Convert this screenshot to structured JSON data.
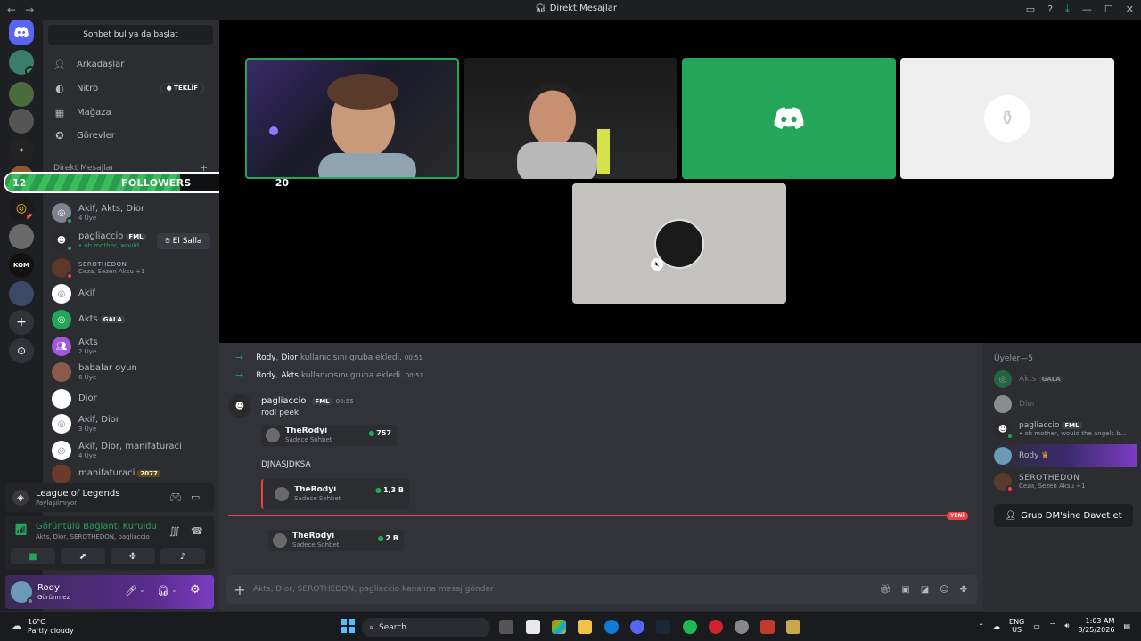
{
  "window": {
    "title": "Direkt Mesajlar"
  },
  "sidebar": {
    "search_label": "Sohbet bul ya da başlat",
    "nav": [
      {
        "label": "Arkadaşlar",
        "icon": "friends-icon"
      },
      {
        "label": "Nitro",
        "icon": "nitro-icon",
        "badge": "TEKLİF"
      },
      {
        "label": "Mağaza",
        "icon": "store-icon"
      },
      {
        "label": "Görevler",
        "icon": "quests-icon"
      }
    ],
    "dm_header": "Direkt Mesajlar",
    "dms": [
      {
        "name": "Akif, Akts, Dior",
        "sub": "4 Üye"
      },
      {
        "name": "pagliaccio",
        "tag": "FML",
        "sub": "• oh mother, would..."
      },
      {
        "name": "SEROTHEDON",
        "sub": "Ceza, Sezen Aksu +1"
      },
      {
        "name": "Akif",
        "sub": ""
      },
      {
        "name": "Akts",
        "tag": "GALA",
        "sub": ""
      },
      {
        "name": "Akts",
        "sub": "2 Üye"
      },
      {
        "name": "babalar oyun",
        "sub": "6 Üye"
      },
      {
        "name": "Dior",
        "sub": ""
      },
      {
        "name": "Akif, Dior",
        "sub": "3 Üye"
      },
      {
        "name": "Akif, Dior, manifaturaci",
        "sub": "4 Üye"
      },
      {
        "name": "manifaturaci",
        "tag": "2077",
        "sub": ""
      }
    ],
    "wave_label": "El Salla",
    "game": {
      "name": "League of Legends",
      "status": "Paylaşılmıyor"
    },
    "voice": {
      "title": "Görüntülü Bağlantı Kuruldu",
      "members": "Akts, Dior, SEROTHEDON, pagliaccio"
    },
    "user": {
      "name": "Rody",
      "status": "Görünmez"
    }
  },
  "followers_widget": {
    "current": "12",
    "label": "FOLLOWERS",
    "goal": "20",
    "progress": 0.6
  },
  "chat": {
    "system_messages": [
      {
        "actor": "Rody",
        "target": "Dior",
        "text": "kullanıcısını gruba ekledi.",
        "time": "00:51"
      },
      {
        "actor": "Rody",
        "target": "Akts",
        "text": "kullanıcısını gruba ekledi.",
        "time": "00:51"
      }
    ],
    "message": {
      "author": "pagliaccio",
      "tag": "FML",
      "time": "00:55",
      "lines": [
        "rodi peek",
        "DJNASJDKSA"
      ]
    },
    "embeds": [
      {
        "name": "TheRodyi",
        "sub": "Sadece Sohbet",
        "count": "757"
      },
      {
        "name": "TheRodyi",
        "sub": "Sadece Sohbet",
        "count": "1,3 B"
      },
      {
        "name": "TheRodyi",
        "sub": "Sadece Sohbet",
        "count": "2 B"
      }
    ],
    "new_label": "YENİ",
    "composer_placeholder": "Akts, Dior, SEROTHEDON, pagliaccio kanalına mesaj gönder"
  },
  "members": {
    "header": "Üyeler—5",
    "list": [
      {
        "name": "Akts",
        "tag": "GALA"
      },
      {
        "name": "Dior",
        "tag": ""
      },
      {
        "name": "pagliaccio",
        "tag": "FML",
        "sub": "• oh mother, would the angels b..."
      },
      {
        "name": "Rody",
        "tag": ""
      },
      {
        "name": "SEROTHEDON",
        "tag": "",
        "sub": "Ceza, Sezen Aksu +1"
      }
    ],
    "invite_label": "Grup DM'sine Davet et"
  },
  "taskbar": {
    "temp": "16°C",
    "weather": "Partly cloudy",
    "search": "Search",
    "lang1": "ENG",
    "lang2": "US",
    "time": "1:03 AM",
    "date": "8/25/2026"
  },
  "colors": {
    "accent": "#5865f2",
    "online": "#23a55a",
    "danger": "#f23f43",
    "bg": "#313338"
  }
}
